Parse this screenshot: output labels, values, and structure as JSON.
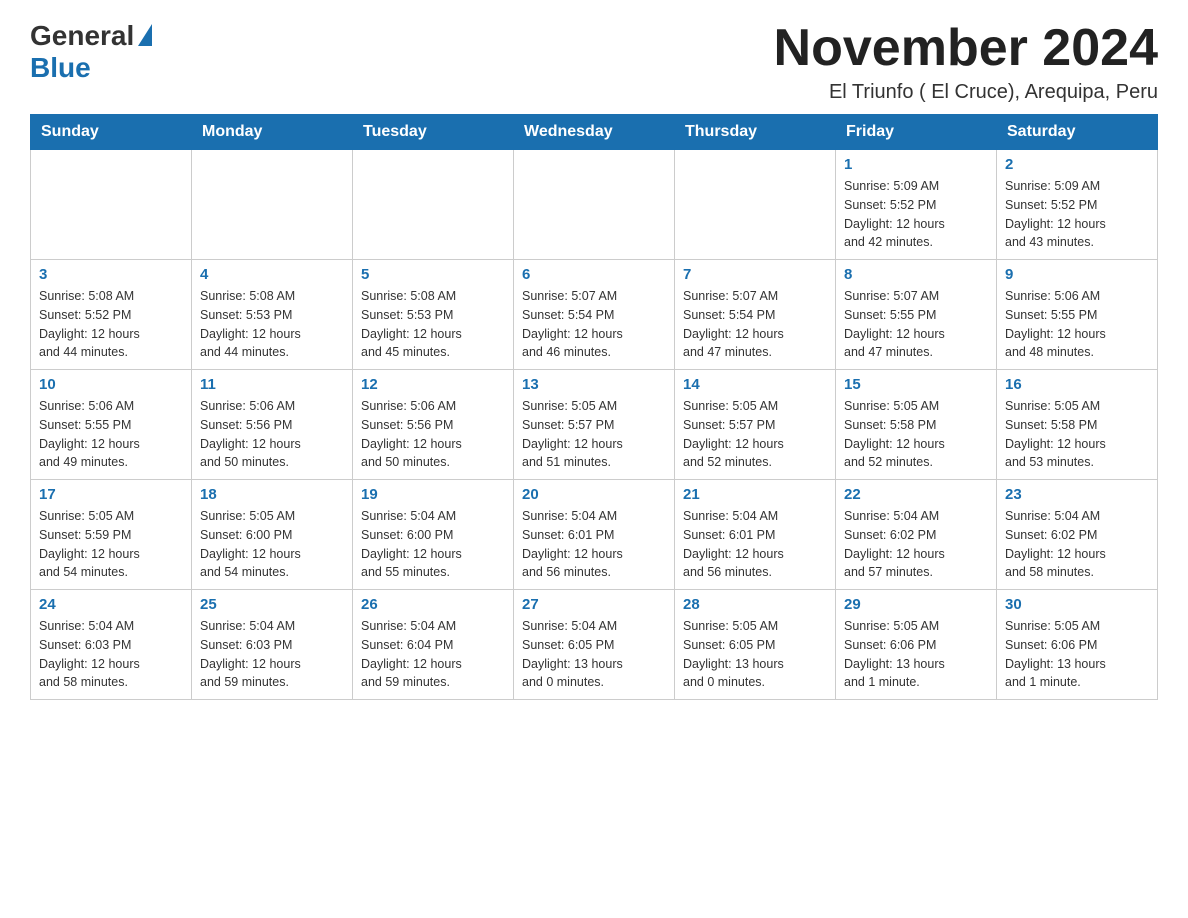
{
  "header": {
    "logo_general": "General",
    "logo_blue": "Blue",
    "month_title": "November 2024",
    "subtitle": "El Triunfo ( El Cruce), Arequipa, Peru"
  },
  "weekdays": [
    "Sunday",
    "Monday",
    "Tuesday",
    "Wednesday",
    "Thursday",
    "Friday",
    "Saturday"
  ],
  "weeks": [
    [
      {
        "day": "",
        "info": ""
      },
      {
        "day": "",
        "info": ""
      },
      {
        "day": "",
        "info": ""
      },
      {
        "day": "",
        "info": ""
      },
      {
        "day": "",
        "info": ""
      },
      {
        "day": "1",
        "info": "Sunrise: 5:09 AM\nSunset: 5:52 PM\nDaylight: 12 hours\nand 42 minutes."
      },
      {
        "day": "2",
        "info": "Sunrise: 5:09 AM\nSunset: 5:52 PM\nDaylight: 12 hours\nand 43 minutes."
      }
    ],
    [
      {
        "day": "3",
        "info": "Sunrise: 5:08 AM\nSunset: 5:52 PM\nDaylight: 12 hours\nand 44 minutes."
      },
      {
        "day": "4",
        "info": "Sunrise: 5:08 AM\nSunset: 5:53 PM\nDaylight: 12 hours\nand 44 minutes."
      },
      {
        "day": "5",
        "info": "Sunrise: 5:08 AM\nSunset: 5:53 PM\nDaylight: 12 hours\nand 45 minutes."
      },
      {
        "day": "6",
        "info": "Sunrise: 5:07 AM\nSunset: 5:54 PM\nDaylight: 12 hours\nand 46 minutes."
      },
      {
        "day": "7",
        "info": "Sunrise: 5:07 AM\nSunset: 5:54 PM\nDaylight: 12 hours\nand 47 minutes."
      },
      {
        "day": "8",
        "info": "Sunrise: 5:07 AM\nSunset: 5:55 PM\nDaylight: 12 hours\nand 47 minutes."
      },
      {
        "day": "9",
        "info": "Sunrise: 5:06 AM\nSunset: 5:55 PM\nDaylight: 12 hours\nand 48 minutes."
      }
    ],
    [
      {
        "day": "10",
        "info": "Sunrise: 5:06 AM\nSunset: 5:55 PM\nDaylight: 12 hours\nand 49 minutes."
      },
      {
        "day": "11",
        "info": "Sunrise: 5:06 AM\nSunset: 5:56 PM\nDaylight: 12 hours\nand 50 minutes."
      },
      {
        "day": "12",
        "info": "Sunrise: 5:06 AM\nSunset: 5:56 PM\nDaylight: 12 hours\nand 50 minutes."
      },
      {
        "day": "13",
        "info": "Sunrise: 5:05 AM\nSunset: 5:57 PM\nDaylight: 12 hours\nand 51 minutes."
      },
      {
        "day": "14",
        "info": "Sunrise: 5:05 AM\nSunset: 5:57 PM\nDaylight: 12 hours\nand 52 minutes."
      },
      {
        "day": "15",
        "info": "Sunrise: 5:05 AM\nSunset: 5:58 PM\nDaylight: 12 hours\nand 52 minutes."
      },
      {
        "day": "16",
        "info": "Sunrise: 5:05 AM\nSunset: 5:58 PM\nDaylight: 12 hours\nand 53 minutes."
      }
    ],
    [
      {
        "day": "17",
        "info": "Sunrise: 5:05 AM\nSunset: 5:59 PM\nDaylight: 12 hours\nand 54 minutes."
      },
      {
        "day": "18",
        "info": "Sunrise: 5:05 AM\nSunset: 6:00 PM\nDaylight: 12 hours\nand 54 minutes."
      },
      {
        "day": "19",
        "info": "Sunrise: 5:04 AM\nSunset: 6:00 PM\nDaylight: 12 hours\nand 55 minutes."
      },
      {
        "day": "20",
        "info": "Sunrise: 5:04 AM\nSunset: 6:01 PM\nDaylight: 12 hours\nand 56 minutes."
      },
      {
        "day": "21",
        "info": "Sunrise: 5:04 AM\nSunset: 6:01 PM\nDaylight: 12 hours\nand 56 minutes."
      },
      {
        "day": "22",
        "info": "Sunrise: 5:04 AM\nSunset: 6:02 PM\nDaylight: 12 hours\nand 57 minutes."
      },
      {
        "day": "23",
        "info": "Sunrise: 5:04 AM\nSunset: 6:02 PM\nDaylight: 12 hours\nand 58 minutes."
      }
    ],
    [
      {
        "day": "24",
        "info": "Sunrise: 5:04 AM\nSunset: 6:03 PM\nDaylight: 12 hours\nand 58 minutes."
      },
      {
        "day": "25",
        "info": "Sunrise: 5:04 AM\nSunset: 6:03 PM\nDaylight: 12 hours\nand 59 minutes."
      },
      {
        "day": "26",
        "info": "Sunrise: 5:04 AM\nSunset: 6:04 PM\nDaylight: 12 hours\nand 59 minutes."
      },
      {
        "day": "27",
        "info": "Sunrise: 5:04 AM\nSunset: 6:05 PM\nDaylight: 13 hours\nand 0 minutes."
      },
      {
        "day": "28",
        "info": "Sunrise: 5:05 AM\nSunset: 6:05 PM\nDaylight: 13 hours\nand 0 minutes."
      },
      {
        "day": "29",
        "info": "Sunrise: 5:05 AM\nSunset: 6:06 PM\nDaylight: 13 hours\nand 1 minute."
      },
      {
        "day": "30",
        "info": "Sunrise: 5:05 AM\nSunset: 6:06 PM\nDaylight: 13 hours\nand 1 minute."
      }
    ]
  ]
}
